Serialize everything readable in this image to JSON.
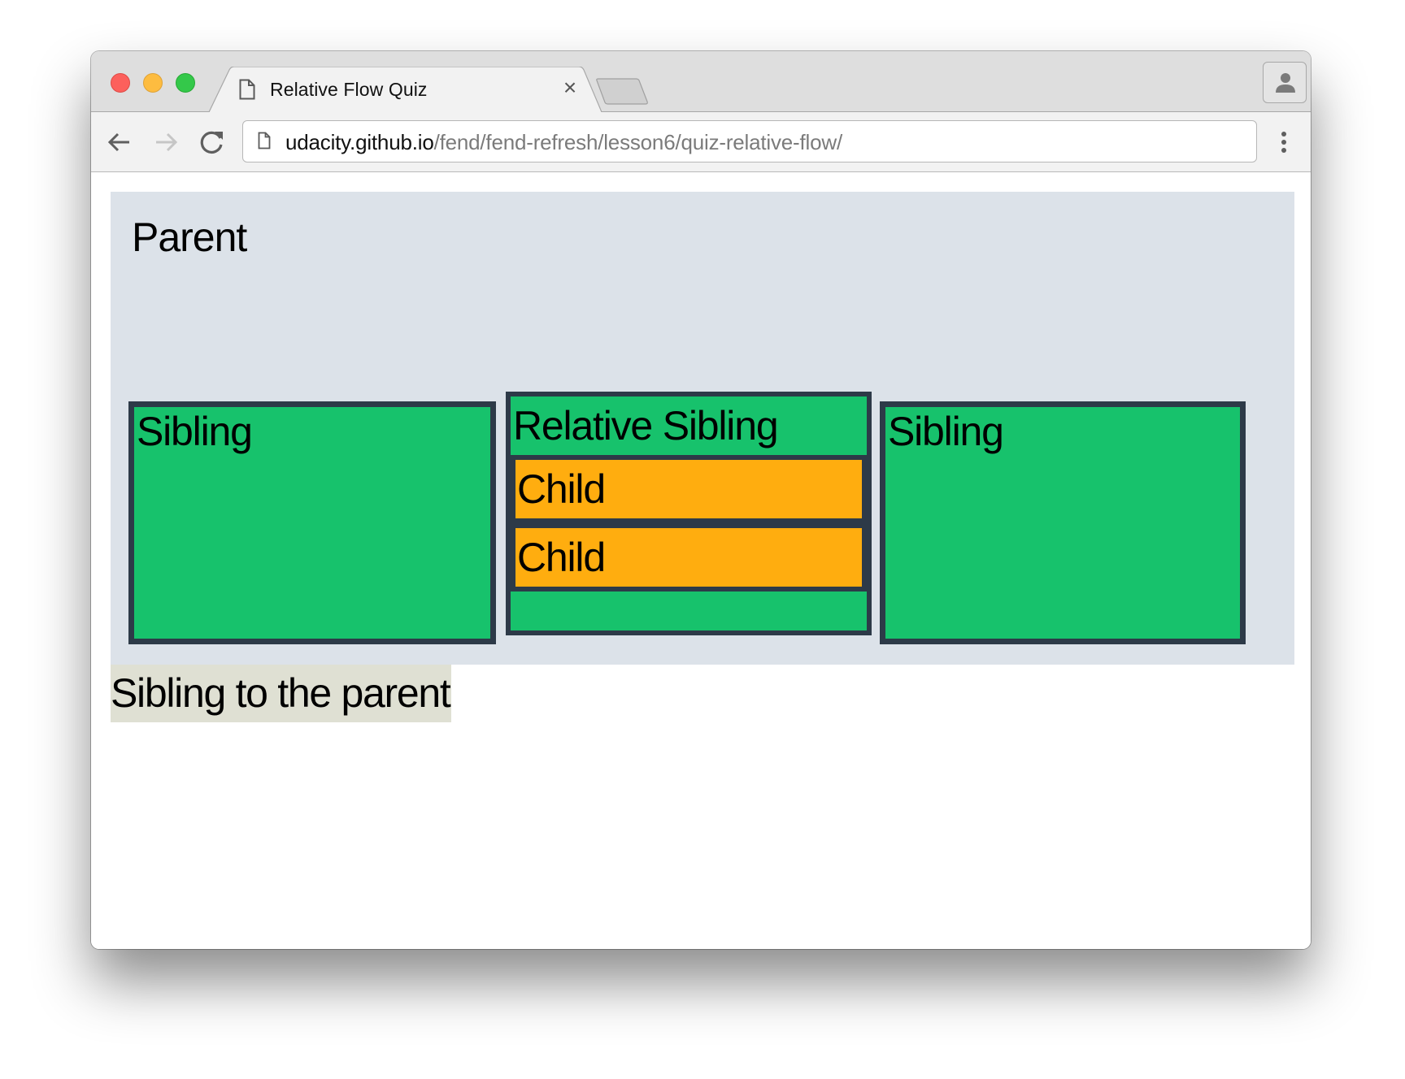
{
  "browser": {
    "window_controls": [
      "close",
      "minimize",
      "maximize"
    ],
    "tab": {
      "title": "Relative Flow Quiz",
      "icon": "document-icon",
      "close_label": "×"
    },
    "new_tab_icon": "new-tab-icon",
    "profile_icon": "person-icon",
    "toolbar": {
      "back_icon": "arrow-left-icon",
      "forward_icon": "arrow-right-icon",
      "reload_icon": "reload-icon",
      "menu_icon": "kebab-menu-icon"
    },
    "address_bar": {
      "page_icon": "document-icon",
      "host": "udacity.github.io",
      "path": "/fend/fend-refresh/lesson6/quiz-relative-flow/"
    }
  },
  "page": {
    "parent": {
      "title": "Parent",
      "background": "#dce2e9"
    },
    "siblings": [
      {
        "label": "Sibling"
      },
      {
        "label": "Relative Sibling",
        "children": [
          {
            "label": "Child"
          },
          {
            "label": "Child"
          }
        ]
      },
      {
        "label": "Sibling"
      }
    ],
    "sibling_to_parent": "Sibling to the parent",
    "colors": {
      "sibling_fill": "#17c26c",
      "border": "#2d3a48",
      "child_fill": "#ffad0f",
      "sibling_to_parent_bg": "#dfe0d3"
    }
  }
}
